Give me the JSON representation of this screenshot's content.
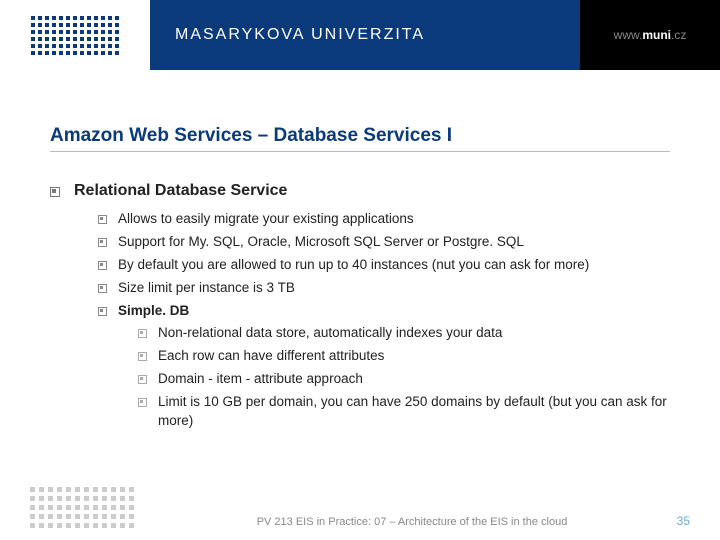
{
  "header": {
    "university": "MASARYKOVA UNIVERZITA",
    "url_prefix": "www.",
    "url_main": "muni",
    "url_suffix": ".cz"
  },
  "slide": {
    "title": "Amazon Web Services – Database Services I",
    "section1_heading": "Relational Database Service",
    "section1_items": [
      "Allows to easily migrate your existing applications",
      "Support for My. SQL, Oracle, Microsoft SQL Server or Postgre. SQL",
      "By default you are allowed to run up to 40 instances (nut you can ask for more)",
      "Size limit per instance is 3 TB"
    ],
    "section2_heading": "Simple. DB",
    "section2_items": [
      "Non-relational data store, automatically indexes your data",
      "Each row can have different attributes",
      "Domain - item - attribute approach",
      "Limit is 10 GB per domain, you can have 250 domains by default (but you can ask for more)"
    ]
  },
  "footer": {
    "text": "PV 213 EIS in Practice: 07 – Architecture of the EIS in the cloud",
    "page": "35"
  }
}
